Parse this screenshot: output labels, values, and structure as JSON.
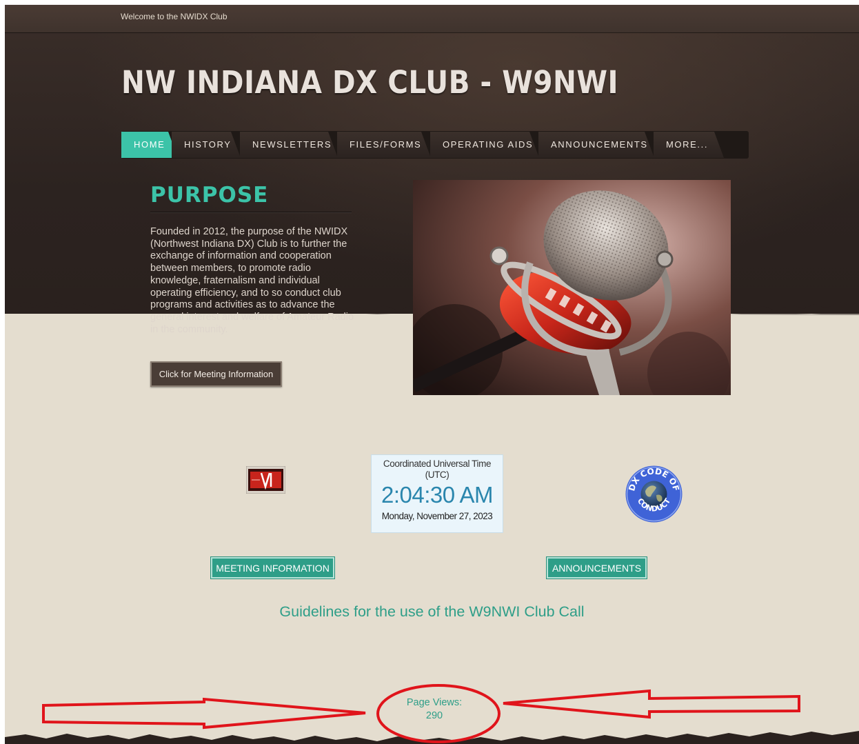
{
  "topbar": {
    "welcome": "Welcome to the NWIDX Club"
  },
  "site": {
    "title": "NW INDIANA DX CLUB - W9NWI"
  },
  "nav": [
    {
      "label": "HOME",
      "active": true
    },
    {
      "label": "HISTORY",
      "active": false
    },
    {
      "label": "NEWSLETTERS",
      "active": false
    },
    {
      "label": "FILES/FORMS",
      "active": false
    },
    {
      "label": "OPERATING AIDS",
      "active": false
    },
    {
      "label": "ANNOUNCEMENTS",
      "active": false
    },
    {
      "label": "MORE...",
      "active": false
    }
  ],
  "purpose": {
    "title": "PURPOSE",
    "text": "Founded in 2012, the purpose of the NWIDX (Northwest Indiana DX) Club is to further the exchange of information and cooperation between members, to promote radio knowledge, fraternalism and individual operating efficiency, and to so conduct club programs and activities as to advance the general interest and welfare of Amateur Radio in the community.",
    "button_label": "Click for Meeting Information"
  },
  "clock": {
    "title": "Coordinated Universal Time (UTC)",
    "time": "2:04:30 AM",
    "date": "Monday, November 27, 2023"
  },
  "dx_badge": {
    "text_top": "DX CODE OF",
    "text_bottom": "CONDUCT"
  },
  "buttons": {
    "meeting": "MEETING INFORMATION",
    "announcements": "ANNOUNCEMENTS"
  },
  "guidelines": "Guidelines for the use of the W9NWI Club Call",
  "page_views": {
    "label": "Page Views:",
    "count": "290"
  },
  "colors": {
    "accent": "#3cc3a8",
    "accent_dark": "#2e9e88",
    "header_bg": "#2c2320",
    "body_bg": "#e4ddcf",
    "annotation": "#e0141b"
  },
  "icons": [
    "microphone-image",
    "ham-radio-badge-icon",
    "dx-code-of-conduct-globe-icon"
  ]
}
